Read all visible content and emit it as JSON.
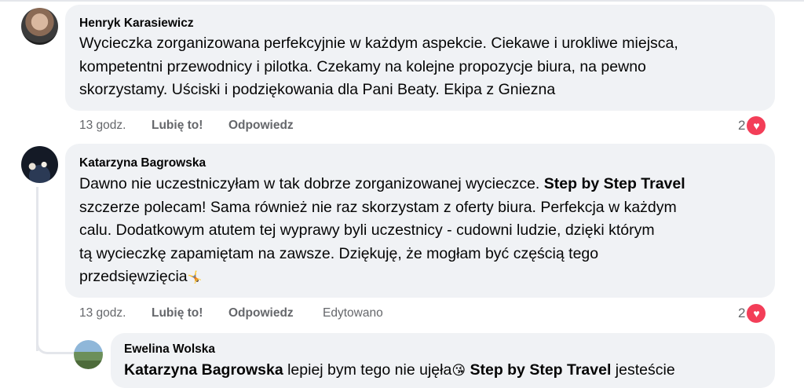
{
  "comments": [
    {
      "author": "Henryk Karasiewicz",
      "lines": [
        "Wycieczka zorganizowana perfekcyjnie w każdym aspekcie. Ciekawe i urokliwe miejsca,",
        "kompetentni przewodnicy i pilotka. Czekamy na kolejne propozycje biura, na pewno",
        "skorzystamy. Uściski i podziękowania dla Pani Beaty. Ekipa z Gniezna"
      ],
      "time": "13 godz.",
      "like_label": "Lubię to!",
      "reply_label": "Odpowiedz",
      "reaction_count": "2"
    },
    {
      "author": "Katarzyna Bagrowska",
      "line1_pre": "Dawno nie uczestniczyłam w tak dobrze zorganizowanej wycieczce. ",
      "line1_tag": "Step by Step Travel",
      "lines": [
        "szczerze polecam! Sama również nie raz skorzystam z oferty biura. Perfekcja w każdym",
        "calu. Dodatkowym atutem tej wyprawy byli uczestnicy - cudowni ludzie, dzięki którym",
        "tą wycieczkę zapamiętam na zawsze. Dziękuję, że mogłam być częścią tego",
        "przedsięwzięcia"
      ],
      "emoji": "🤸",
      "time": "13 godz.",
      "like_label": "Lubię to!",
      "reply_label": "Odpowiedz",
      "edited_label": "Edytowano",
      "reaction_count": "2"
    },
    {
      "author": "Ewelina Wolska",
      "tag1": "Katarzyna Bagrowska",
      "mid_text": " lepiej bym tego nie ujęła",
      "emoji": "😘",
      "tag2": "Step by Step Travel",
      "end_text": " jesteście"
    }
  ],
  "colors": {
    "bubble": "#f0f2f5",
    "meta": "#65676b",
    "heart": "#f33e58"
  },
  "icons": {
    "reaction": "heart-reaction-icon"
  }
}
